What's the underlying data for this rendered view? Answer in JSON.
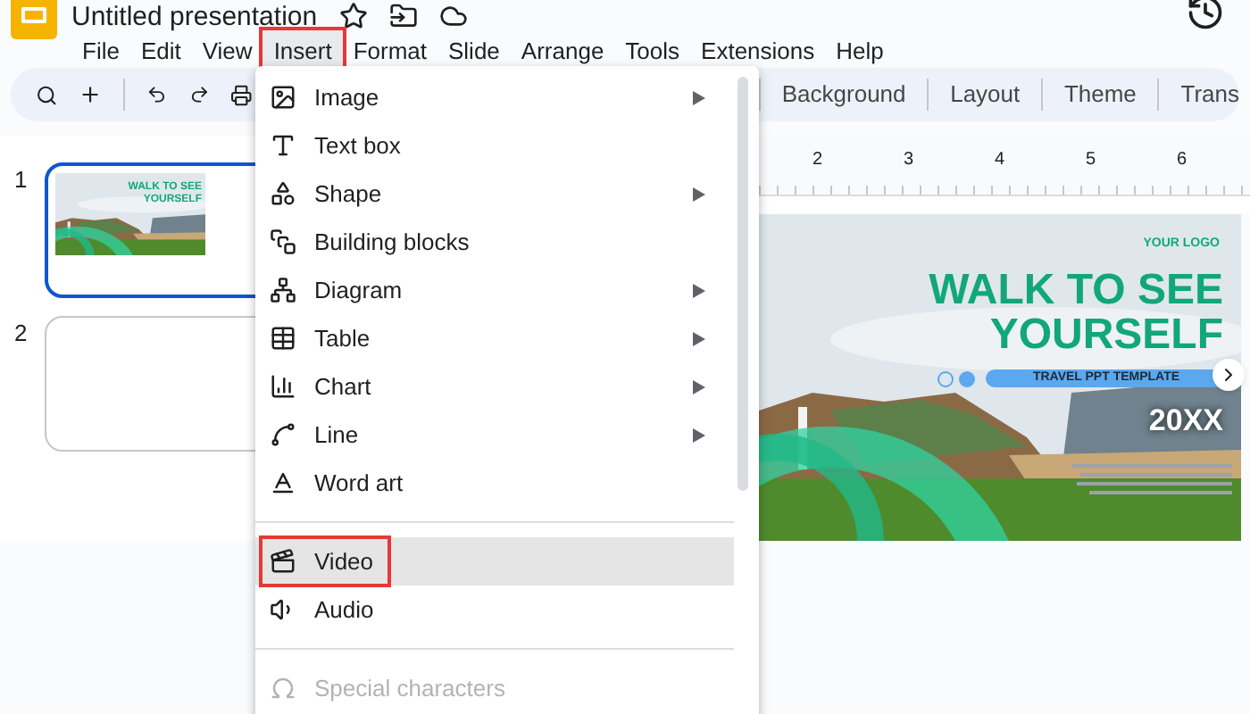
{
  "document": {
    "title": "Untitled presentation"
  },
  "menubar": [
    {
      "label": "File",
      "selected": false
    },
    {
      "label": "Edit",
      "selected": false
    },
    {
      "label": "View",
      "selected": false
    },
    {
      "label": "Insert",
      "selected": true
    },
    {
      "label": "Format",
      "selected": false
    },
    {
      "label": "Slide",
      "selected": false
    },
    {
      "label": "Arrange",
      "selected": false
    },
    {
      "label": "Tools",
      "selected": false
    },
    {
      "label": "Extensions",
      "selected": false
    },
    {
      "label": "Help",
      "selected": false
    }
  ],
  "toolbar": {
    "buttons": [
      "Background",
      "Layout",
      "Theme",
      "Trans"
    ]
  },
  "ruler": {
    "marks": [
      "2",
      "3",
      "4",
      "5",
      "6"
    ]
  },
  "slides": [
    {
      "number": "1",
      "selected": true,
      "thumbnail_title": "WALK TO SEE YOURSELF"
    },
    {
      "number": "2",
      "selected": false
    }
  ],
  "slide": {
    "logo": "YOUR LOGO",
    "title": "WALK TO SEE YOURSELF",
    "subtitle": "TRAVEL PPT TEMPLATE",
    "year": "20XX"
  },
  "insert_menu": {
    "groups": [
      [
        {
          "label": "Image",
          "has_submenu": true,
          "highlighted": false,
          "disabled": false
        },
        {
          "label": "Text box",
          "has_submenu": false,
          "highlighted": false,
          "disabled": false
        },
        {
          "label": "Shape",
          "has_submenu": true,
          "highlighted": false,
          "disabled": false
        },
        {
          "label": "Building blocks",
          "has_submenu": false,
          "highlighted": false,
          "disabled": false
        },
        {
          "label": "Diagram",
          "has_submenu": true,
          "highlighted": false,
          "disabled": false
        },
        {
          "label": "Table",
          "has_submenu": true,
          "highlighted": false,
          "disabled": false
        },
        {
          "label": "Chart",
          "has_submenu": true,
          "highlighted": false,
          "disabled": false
        },
        {
          "label": "Line",
          "has_submenu": true,
          "highlighted": false,
          "disabled": false
        },
        {
          "label": "Word art",
          "has_submenu": false,
          "highlighted": false,
          "disabled": false
        }
      ],
      [
        {
          "label": "Video",
          "has_submenu": false,
          "highlighted": true,
          "disabled": false
        },
        {
          "label": "Audio",
          "has_submenu": false,
          "highlighted": false,
          "disabled": false
        }
      ],
      [
        {
          "label": "Special characters",
          "has_submenu": false,
          "highlighted": false,
          "disabled": true
        }
      ]
    ]
  }
}
